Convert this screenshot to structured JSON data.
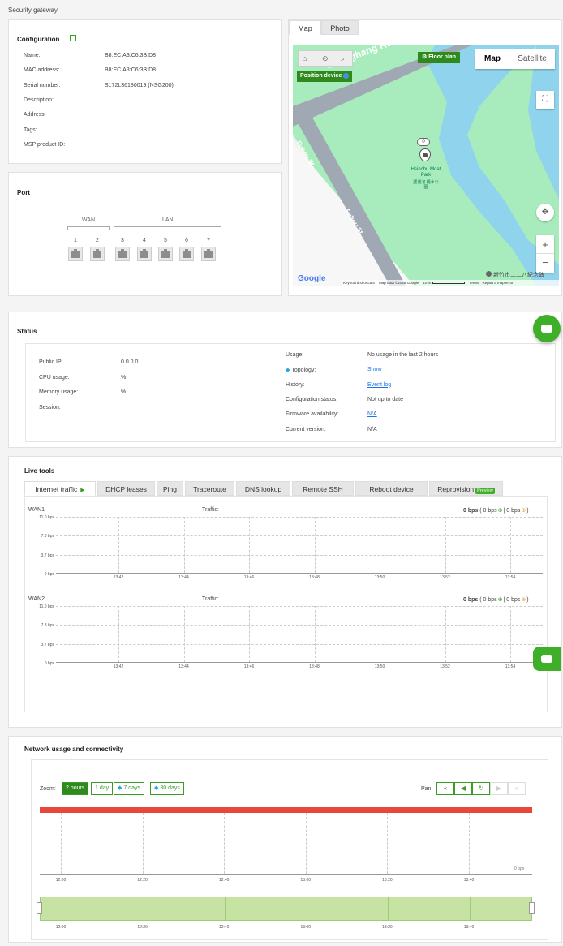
{
  "page_title": "Security gateway",
  "config": {
    "title": "Configuration",
    "edit_icon": "edit-icon",
    "fields": [
      {
        "label": "Name:",
        "value": "B8:EC:A3:C6:3B:D8"
      },
      {
        "label": "MAC address:",
        "value": "B8:EC:A3:C6:3B:D8"
      },
      {
        "label": "Serial number:",
        "value": "S172L36180019 (NSG200)"
      },
      {
        "label": "Description:",
        "value": ""
      },
      {
        "label": "Address:",
        "value": ""
      },
      {
        "label": "Tags:",
        "value": ""
      },
      {
        "label": "MSP product ID:",
        "value": ""
      }
    ]
  },
  "port": {
    "title": "Port",
    "wan_label": "WAN",
    "lan_label": "LAN",
    "numbers": [
      "1",
      "2",
      "3",
      "4",
      "5",
      "6",
      "7"
    ]
  },
  "map": {
    "tabs": [
      "Map",
      "Photo"
    ],
    "floor_plan": "Floor plan",
    "position_device": "Position device",
    "map_btn": "Map",
    "satellite_btn": "Satellite",
    "road1": "Zhonghang Rd",
    "road2": "Fuhou St",
    "road3": "Fuhou St",
    "park_name": "Hsinchu Moat Park",
    "park_cn": "護城河 親水公園",
    "pin_count": "0",
    "place_label": "新竹市二二八紀念碑",
    "google": "Google",
    "keyboard": "Keyboard shortcuts",
    "map_data": "Map data ©2026 Google",
    "scale": "10 m",
    "terms": "Terms",
    "report": "Report a map error"
  },
  "status": {
    "title": "Status",
    "left": [
      {
        "label": "Public IP:",
        "value": "0.0.0.0"
      },
      {
        "label": "CPU usage:",
        "value": "%"
      },
      {
        "label": "Memory usage:",
        "value": "%"
      },
      {
        "label": "Session:",
        "value": ""
      }
    ],
    "right": [
      {
        "label": "Usage:",
        "value": "No usage in the last 2 hours",
        "link": false
      },
      {
        "label": "Topology:",
        "value": "Show",
        "link": true
      },
      {
        "label": "History:",
        "value": "Event log",
        "link": true
      },
      {
        "label": "Configuration status:",
        "value": "Not up to date",
        "link": false
      },
      {
        "label": "Firmware availability:",
        "value": "N/A",
        "link": true
      },
      {
        "label": "Current version:",
        "value": "N/A",
        "link": false
      }
    ]
  },
  "live": {
    "title": "Live tools",
    "tabs": [
      "Internet traffic",
      "DHCP leases",
      "Ping",
      "Traceroute",
      "DNS lookup",
      "Remote SSH",
      "Reboot device",
      "Reprovision"
    ],
    "preview_badge": "Preview",
    "charts": [
      {
        "wan": "WAN1",
        "traffic": "Traffic:",
        "total": "0 bps",
        "down": "( 0 bps",
        "sep": "| 0 bps",
        "close": ")"
      },
      {
        "wan": "WAN2",
        "traffic": "Traffic:",
        "total": "0 bps",
        "down": "( 0 bps",
        "sep": "| 0 bps",
        "close": ")"
      }
    ],
    "yticks": [
      "11.0 bps",
      "7.3 bps",
      "3.7 bps",
      "0 bps"
    ],
    "xticks": [
      "13:42",
      "13:44",
      "13:46",
      "13:48",
      "13:50",
      "13:52",
      "13:54"
    ]
  },
  "network": {
    "title": "Network usage and connectivity",
    "zoom_label": "Zoom:",
    "zoom": [
      "2 hours",
      "1 day",
      "7 days",
      "30 days"
    ],
    "pan_label": "Pan:",
    "yzero": "0 bps",
    "xticks": [
      "12:00",
      "12:20",
      "12:40",
      "13:00",
      "13:20",
      "13:40"
    ]
  },
  "colors": {
    "accent": "#2e8a1c",
    "red_bar": "#e8483a",
    "map_green": "#a8ecbd",
    "water": "#8fd3ec"
  }
}
